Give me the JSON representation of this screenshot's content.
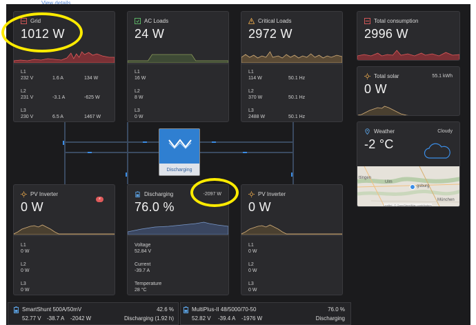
{
  "top_link": "View details",
  "grid": {
    "title": "Grid",
    "value": "1012 W",
    "phases": [
      {
        "label": "L1",
        "voltage": "232 V",
        "current": "1.6 A",
        "power": "134 W"
      },
      {
        "label": "L2",
        "voltage": "231 V",
        "current": "-3.1 A",
        "power": "-625 W"
      },
      {
        "label": "L3",
        "voltage": "230 V",
        "current": "6.5 A",
        "power": "1467 W"
      }
    ]
  },
  "ac_loads": {
    "title": "AC Loads",
    "value": "24 W",
    "phases": [
      {
        "label": "L1",
        "power": "16 W"
      },
      {
        "label": "L2",
        "power": "8 W"
      },
      {
        "label": "L3",
        "power": "0 W"
      }
    ]
  },
  "critical_loads": {
    "title": "Critical Loads",
    "value": "2972 W",
    "phases": [
      {
        "label": "L1",
        "power": "114 W",
        "freq": "50.1 Hz"
      },
      {
        "label": "L2",
        "power": "370 W",
        "freq": "50.1 Hz"
      },
      {
        "label": "L3",
        "power": "2488 W",
        "freq": "50.1 Hz"
      }
    ]
  },
  "total_consumption": {
    "title": "Total consumption",
    "value": "2996 W"
  },
  "total_solar": {
    "title": "Total solar",
    "value": "0 W",
    "energy": "55.1 kWh"
  },
  "weather": {
    "title": "Weather",
    "condition": "Cloudy",
    "temp": "-2 °C",
    "map_labels": [
      "ttingen",
      "Ulm",
      "gsburg",
      "München"
    ],
    "attribution": "Leaflet | © OpenStreetMap contributors"
  },
  "inverter_center": {
    "status": "Discharging"
  },
  "pv_inverter_1": {
    "title": "PV Inverter",
    "value": "0 W",
    "phases": [
      {
        "label": "L1",
        "power": "0 W"
      },
      {
        "label": "L2",
        "power": "0 W"
      },
      {
        "label": "L3",
        "power": "0 W"
      }
    ]
  },
  "battery": {
    "title": "Discharging",
    "power": "-2097 W",
    "soc": "76.0 %",
    "voltage_label": "Voltage",
    "voltage": "52.84 V",
    "current_label": "Current",
    "current": "-39.7 A",
    "temp_label": "Temperature",
    "temp": "28 °C"
  },
  "pv_inverter_2": {
    "title": "PV Inverter",
    "value": "0 W",
    "phases": [
      {
        "label": "L1",
        "power": "0 W"
      },
      {
        "label": "L2",
        "power": "0 W"
      },
      {
        "label": "L3",
        "power": "0 W"
      }
    ]
  },
  "smartshunt": {
    "name": "SmartShunt 500A/50mV",
    "soc": "42.6 %",
    "voltage": "52.77 V",
    "current": "-38.7 A",
    "power": "-2042 W",
    "status": "Discharging (1.92 h)"
  },
  "multiplus": {
    "name": "MultiPlus-II 48/5000/70-50",
    "soc": "76.0 %",
    "voltage": "52.82 V",
    "current": "-39.4 A",
    "power": "-1976 W",
    "status": "Discharging"
  },
  "colors": {
    "grid": "#e05a5a",
    "ac": "#5fbf6a",
    "critical": "#e0a24a",
    "solar": "#e0a24a",
    "accent": "#3b8de6",
    "highlight": "#ffeb00"
  },
  "icons": {
    "grid": "grid-icon",
    "ac": "ac-loads-icon",
    "critical": "warning-icon",
    "consumption": "consumption-icon",
    "solar": "sun-icon",
    "weather": "location-icon",
    "battery": "battery-icon"
  }
}
